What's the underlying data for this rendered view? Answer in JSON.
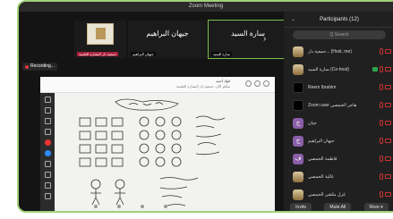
{
  "window": {
    "title": "Zoom Meeting"
  },
  "thumbnails": [
    {
      "name_big": "",
      "name_small": "جمعية دار البشارة العلمية",
      "small_red": true,
      "image": true,
      "active": false
    },
    {
      "name_big": "جيهان البراهيم",
      "name_small": "جيهان البراهيم",
      "small_red": false,
      "image": false,
      "active": false
    },
    {
      "name_big": "سارة السيد",
      "name_small": "سارة السيد",
      "small_red": false,
      "image": false,
      "active": true
    }
  ],
  "recording": {
    "label": "Recording..."
  },
  "share": {
    "header_line1": "فؤاد أحمد",
    "header_line2": "يتكلم الآن: جمعية دار البشارة العلمية"
  },
  "participants": {
    "title": "Participants (12)",
    "search_placeholder": "Q Search",
    "items": [
      {
        "name": "جمعية دار... (Host, me)",
        "avatar": "img",
        "letter": "",
        "green": false
      },
      {
        "name": "سارة السيد (Co-host)",
        "avatar": "img",
        "letter": "",
        "green": true
      },
      {
        "name": "Reem Ibrahim",
        "avatar": "black",
        "letter": "",
        "green": false
      },
      {
        "name": "Zoom user هاجر الحمصي",
        "avatar": "black",
        "letter": "",
        "green": false
      },
      {
        "name": "جيان",
        "avatar": "purple",
        "letter": "ج",
        "green": false
      },
      {
        "name": "جيهان البراهيم",
        "avatar": "purple",
        "letter": "ج",
        "green": false
      },
      {
        "name": "فاطمة الحمصي",
        "avatar": "purple",
        "letter": "ف",
        "green": false
      },
      {
        "name": "غالية الحمصي",
        "avatar": "img",
        "letter": "",
        "green": false
      },
      {
        "name": "غزل ملتقى الحمصي",
        "avatar": "img",
        "letter": "",
        "green": false
      }
    ],
    "footer": {
      "invite": "Invite",
      "mute_all": "Mute All",
      "more": "More ▾"
    }
  },
  "colors": {
    "frame_border": "#9fd07a",
    "recording_dot": "#e8343f",
    "accent_blue": "#2d8cff"
  }
}
